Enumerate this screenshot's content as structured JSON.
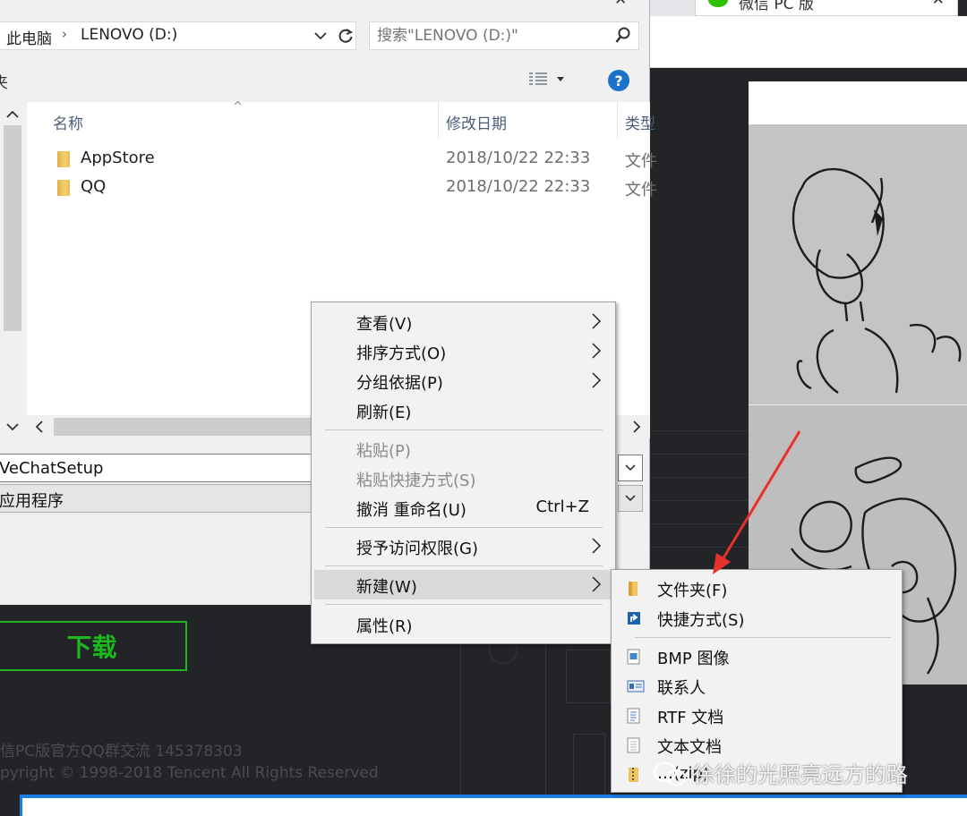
{
  "browser": {
    "tab_title": "微信 PC 版",
    "tab_close": "✕"
  },
  "page": {
    "download_button": "下载",
    "footer_line_1": "信PC版官方QQ群交流 145378303",
    "footer_line_2": "pyright © 1998-2018 Tencent All Rights Reserved"
  },
  "explorer": {
    "close_glyph": "✕",
    "breadcrumb": [
      "此电脑",
      "LENOVO (D:)"
    ],
    "breadcrumb_separator": "›",
    "search_placeholder": "搜索\"LENOVO (D:)\"",
    "toolbar_label": "夹",
    "columns": {
      "name": "名称",
      "modified": "修改日期",
      "type": "类型"
    },
    "files": [
      {
        "name": "AppStore",
        "modified": "2018/10/22 22:33",
        "type": "文件"
      },
      {
        "name": "QQ",
        "modified": "2018/10/22 22:33",
        "type": "文件"
      }
    ],
    "filename_value": "VeChatSetup",
    "filetype_value": "应用程序",
    "help_glyph": "?"
  },
  "context_menu": {
    "items": [
      {
        "label": "查看(V)",
        "submenu": true,
        "disabled": false
      },
      {
        "label": "排序方式(O)",
        "submenu": true,
        "disabled": false
      },
      {
        "label": "分组依据(P)",
        "submenu": true,
        "disabled": false
      },
      {
        "label": "刷新(E)",
        "submenu": false,
        "disabled": false
      },
      {
        "label": "粘贴(P)",
        "submenu": false,
        "disabled": true
      },
      {
        "label": "粘贴快捷方式(S)",
        "submenu": false,
        "disabled": true
      },
      {
        "label": "撤消 重命名(U)",
        "submenu": false,
        "disabled": false,
        "shortcut": "Ctrl+Z"
      },
      {
        "label": "授予访问权限(G)",
        "submenu": true,
        "disabled": false
      },
      {
        "label": "新建(W)",
        "submenu": true,
        "disabled": false,
        "highlighted": true
      },
      {
        "label": "属性(R)",
        "submenu": false,
        "disabled": false
      }
    ]
  },
  "new_submenu": {
    "items": [
      {
        "label": "文件夹(F)",
        "icon": "folder-icon"
      },
      {
        "label": "快捷方式(S)",
        "icon": "shortcut-icon"
      },
      {
        "label": "BMP 图像",
        "icon": "bitmap-icon"
      },
      {
        "label": "联系人",
        "icon": "contact-icon"
      },
      {
        "label": "RTF 文档",
        "icon": "rtf-document-icon"
      },
      {
        "label": "文本文档",
        "icon": "text-document-icon"
      },
      {
        "label": "…(zip)",
        "icon": "zip-folder-icon"
      }
    ]
  },
  "watermark": "徐徐的光照亮远方的路",
  "colors": {
    "accent_green": "#1db81d",
    "annotation_red": "#e8312b",
    "help_blue": "#1a72c9"
  }
}
